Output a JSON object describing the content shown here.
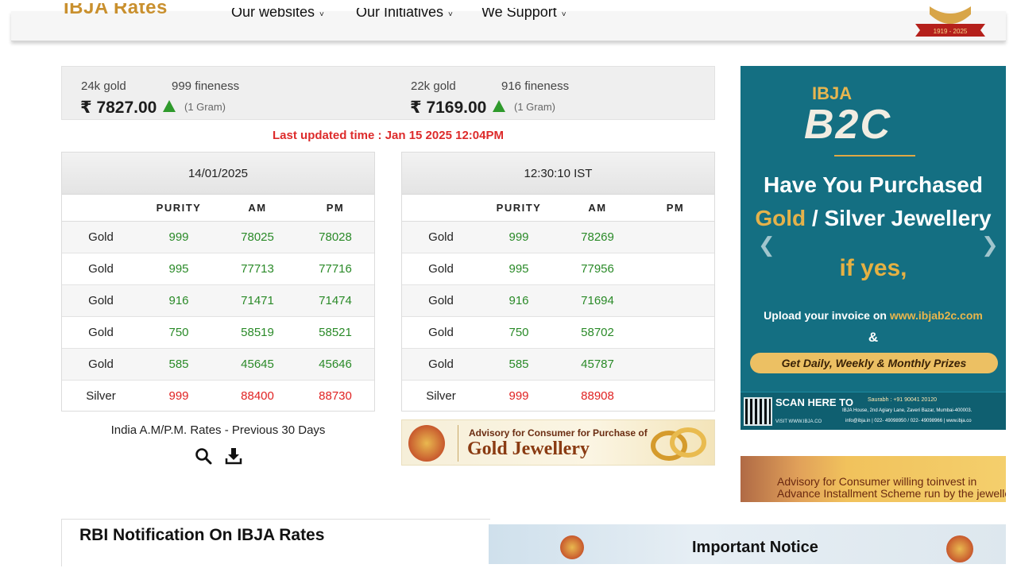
{
  "header": {
    "logo_text": "IBJA Rates",
    "nav": [
      {
        "label": "Our websites"
      },
      {
        "label": "Our Initiatives"
      },
      {
        "label": "We Support"
      }
    ],
    "anniversary_badge": "1919 - 2025"
  },
  "price_strip": {
    "gold24": {
      "karat": "24k gold",
      "fineness": "999 fineness",
      "price": "₹ 7827.00",
      "unit": "(1 Gram)",
      "trend": "up"
    },
    "gold22": {
      "karat": "22k gold",
      "fineness": "916 fineness",
      "price": "₹ 7169.00",
      "unit": "(1 Gram)",
      "trend": "up"
    }
  },
  "last_updated": "Last updated time : Jan 15 2025 12:04PM",
  "colors": {
    "accent_red": "#dd2b2b",
    "value_green": "#2a8a28",
    "silver_red": "#e02222",
    "ad_teal": "#146f82"
  },
  "tables": [
    {
      "title": "14/01/2025",
      "columns": [
        "",
        "PURITY",
        "AM",
        "PM"
      ],
      "rows": [
        {
          "metal": "Gold",
          "purity": "999",
          "am": "78025",
          "pm": "78028"
        },
        {
          "metal": "Gold",
          "purity": "995",
          "am": "77713",
          "pm": "77716"
        },
        {
          "metal": "Gold",
          "purity": "916",
          "am": "71471",
          "pm": "71474"
        },
        {
          "metal": "Gold",
          "purity": "750",
          "am": "58519",
          "pm": "58521"
        },
        {
          "metal": "Gold",
          "purity": "585",
          "am": "45645",
          "pm": "45646"
        },
        {
          "metal": "Silver",
          "purity": "999",
          "am": "88400",
          "pm": "88730"
        }
      ]
    },
    {
      "title": "12:30:10 IST",
      "columns": [
        "",
        "PURITY",
        "AM",
        "PM"
      ],
      "rows": [
        {
          "metal": "Gold",
          "purity": "999",
          "am": "78269",
          "pm": ""
        },
        {
          "metal": "Gold",
          "purity": "995",
          "am": "77956",
          "pm": ""
        },
        {
          "metal": "Gold",
          "purity": "916",
          "am": "71694",
          "pm": ""
        },
        {
          "metal": "Gold",
          "purity": "750",
          "am": "58702",
          "pm": ""
        },
        {
          "metal": "Gold",
          "purity": "585",
          "am": "45787",
          "pm": ""
        },
        {
          "metal": "Silver",
          "purity": "999",
          "am": "88908",
          "pm": ""
        }
      ]
    }
  ],
  "previous_30_days": {
    "label": "India A.M/P.M. Rates - Previous 30 Days",
    "icons": [
      "search-icon",
      "download-icon"
    ]
  },
  "advisory_banner": {
    "line1": "Advisory for Consumer for Purchase of",
    "line2": "Gold Jewellery"
  },
  "ad": {
    "brand": "IBJA",
    "logo": "B2C",
    "headline1": "Have You Purchased",
    "headline2_gold": "Gold",
    "headline2_rest": " / Silver Jewellery",
    "if_yes": "if yes,",
    "upload_text": "Upload your invoice on ",
    "upload_url": "www.ibjab2c.com",
    "amp": "&",
    "prizes": "Get Daily, Weekly & Monthly Prizes",
    "scan": "SCAN HERE TO",
    "visit": "VISIT WWW.IBJA.CO",
    "contact1": "Saurabh : +91 90041 20120",
    "contact2": "IBJA House, 2nd Agiary Lane, Zaveri Bazar, Mumbai-400003.",
    "contact3": "info@ibja.in | 022- 49098950 / 022- 49098966 | www.ibja.co"
  },
  "advisory2": {
    "line1": "Advisory for Consumer willing toinvest in",
    "line2": "Advance Installment Scheme run by the jewelle"
  },
  "rbi_heading": "RBI Notification On IBJA Rates",
  "notice_heading": "Important Notice"
}
